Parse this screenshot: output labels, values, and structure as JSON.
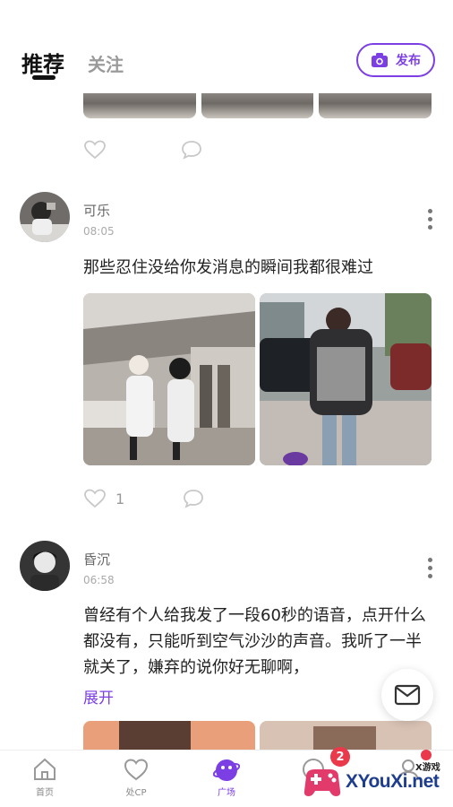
{
  "header": {
    "tab_recommend": "推荐",
    "tab_follow": "关注",
    "publish_label": "发布"
  },
  "prev_post": {
    "like_count": ""
  },
  "posts": [
    {
      "username": "可乐",
      "time": "08:05",
      "text": "那些忍住没给你发消息的瞬间我都很难过",
      "like_count": "1"
    },
    {
      "username": "昏沉",
      "time": "06:58",
      "text": "曾经有个人给我发了一段60秒的语音，点开什么都没有，只能听到空气沙沙的声音。我听了一半就关了，嫌弃的说你好无聊啊，",
      "expand_label": "展开"
    }
  ],
  "tabbar": {
    "items": [
      {
        "label": "首页",
        "icon": "home-icon"
      },
      {
        "label": "处CP",
        "icon": "heart-icon"
      },
      {
        "label": "广场",
        "icon": "plaza-icon"
      },
      {
        "label": "",
        "icon": "message-icon"
      },
      {
        "label": "",
        "icon": "profile-icon"
      }
    ],
    "message_badge": "2"
  },
  "watermark": {
    "brand": "XYouXi.net",
    "sub": "X游戏"
  },
  "colors": {
    "accent": "#7b3fe4",
    "badge": "#e9394b"
  }
}
